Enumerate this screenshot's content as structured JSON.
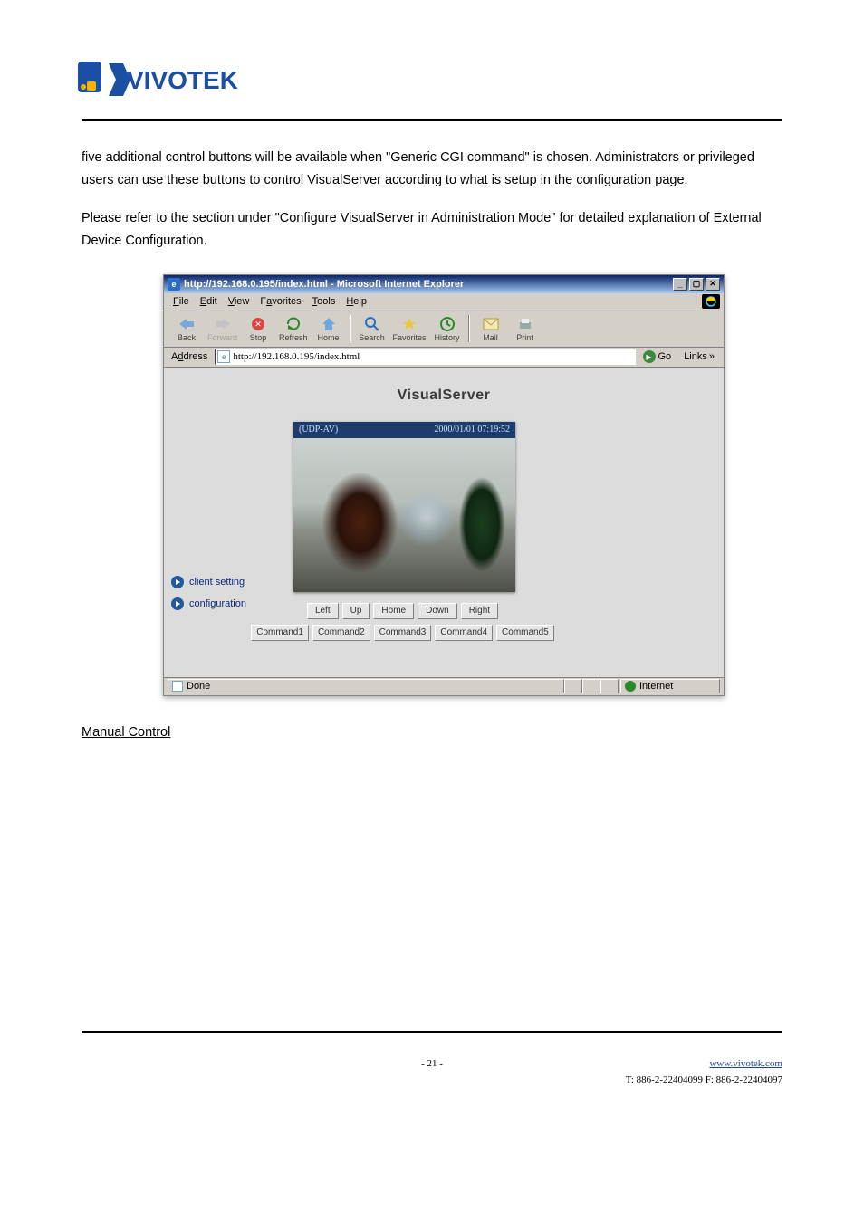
{
  "body": {
    "para1a": "five additional control buttons will be available when ",
    "para1b": "\"Generic CGI command\"",
    "para1c": " is chosen. Administrators or privileged users can use these buttons to control VisualServer according to what is setup in the configuration page.",
    "para2a": "Please refer to the section under ",
    "para2b": "\"Configure VisualServer in Administration Mode\"",
    "para2c": " for detailed explanation of External Device Configuration.",
    "link_below": "Manual Control"
  },
  "ie": {
    "title": "http://192.168.0.195/index.html - Microsoft Internet Explorer",
    "menus": [
      "File",
      "Edit",
      "View",
      "Favorites",
      "Tools",
      "Help"
    ],
    "toolbar": [
      {
        "name": "back",
        "label": "Back",
        "disabled": false
      },
      {
        "name": "forward",
        "label": "Forward",
        "disabled": true
      },
      {
        "name": "stop",
        "label": "Stop",
        "disabled": false
      },
      {
        "name": "refresh",
        "label": "Refresh",
        "disabled": false
      },
      {
        "name": "home",
        "label": "Home",
        "disabled": false
      },
      {
        "name": "search",
        "label": "Search",
        "disabled": false
      },
      {
        "name": "favorites",
        "label": "Favorites",
        "disabled": false
      },
      {
        "name": "history",
        "label": "History",
        "disabled": false
      },
      {
        "name": "mail",
        "label": "Mail",
        "disabled": false
      },
      {
        "name": "print",
        "label": "Print",
        "disabled": false
      }
    ],
    "address_label": "Address",
    "address_value": "http://192.168.0.195/index.html",
    "go": "Go",
    "links": "Links",
    "status_done": "Done",
    "status_net": "Internet"
  },
  "vs": {
    "title": "VisualServer",
    "video_overlay_left": "(UDP-AV)",
    "video_overlay_right": "2000/01/01 07:19:52",
    "sidebar": [
      {
        "label": "client setting"
      },
      {
        "label": "configuration"
      }
    ],
    "dir_buttons": [
      "Left",
      "Up",
      "Home",
      "Down",
      "Right"
    ],
    "cmd_buttons": [
      "Command1",
      "Command2",
      "Command3",
      "Command4",
      "Command5"
    ]
  },
  "footer": {
    "page": "- 21 -",
    "site": "www.vivotek.com",
    "tel": "T: 886-2-22404099   F: 886-2-22404097"
  }
}
